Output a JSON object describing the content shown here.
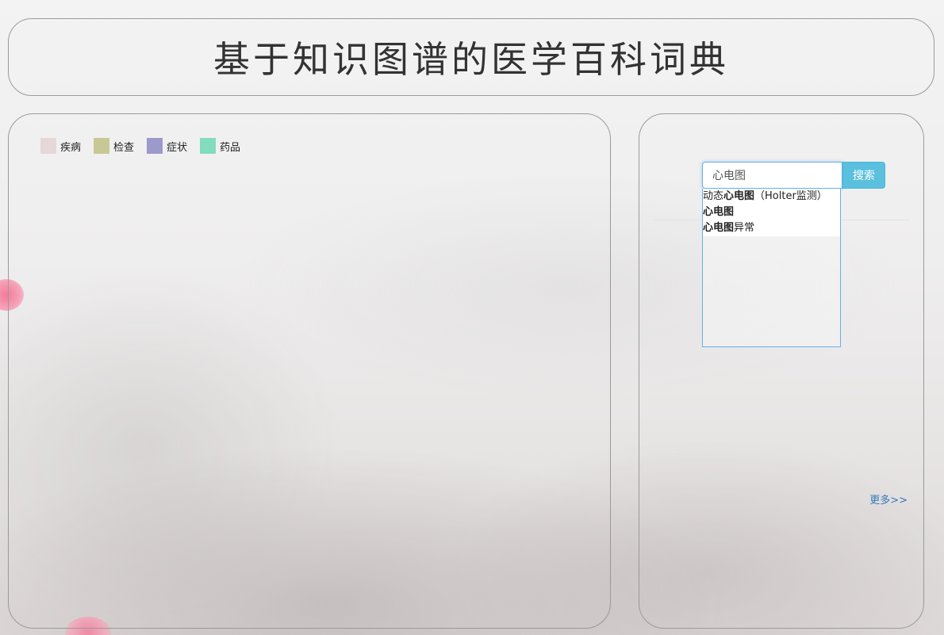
{
  "header": {
    "title": "基于知识图谱的医学百科词典"
  },
  "legend": [
    {
      "label": "疾病",
      "color": "#e6d7d9"
    },
    {
      "label": "检查",
      "color": "#c8c796"
    },
    {
      "label": "症状",
      "color": "#9c99cb"
    },
    {
      "label": "药品",
      "color": "#82dcbd"
    }
  ],
  "search": {
    "input_value": "心电图",
    "button_label": "搜索",
    "accent_color": "#5bc0de"
  },
  "suggestions": [
    {
      "prefix": "动态",
      "match": "心电图",
      "suffix": "（Holter监测）"
    },
    {
      "prefix": "",
      "match": "心电图",
      "suffix": ""
    },
    {
      "prefix": "",
      "match": "心电图",
      "suffix": "异常"
    }
  ],
  "more_link": "更多>>"
}
